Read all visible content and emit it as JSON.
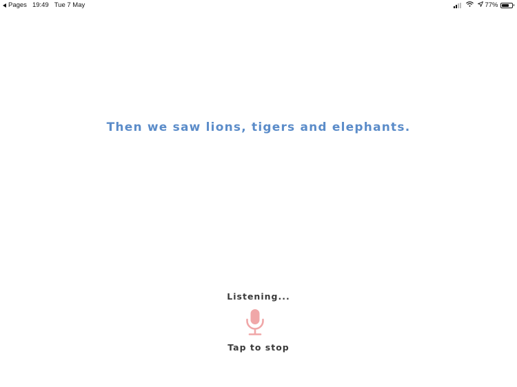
{
  "status_bar": {
    "back_app": "Pages",
    "time": "19:49",
    "date": "Tue 7 May",
    "battery_percent": "77%",
    "battery_level": 0.77,
    "icons": [
      "back-arrow-icon",
      "cellular-signal-icon",
      "wifi-icon",
      "location-arrow-icon",
      "battery-icon"
    ]
  },
  "main": {
    "sentence": "Then we saw lions, tigers and elephants.",
    "listening_label": "Listening...",
    "mic_icon": "microphone-icon",
    "tap_label": "Tap to stop"
  },
  "colors": {
    "sentence_text": "#5b8cc9",
    "mic": "#f0a7a8",
    "label_text": "#3a3a3a"
  }
}
